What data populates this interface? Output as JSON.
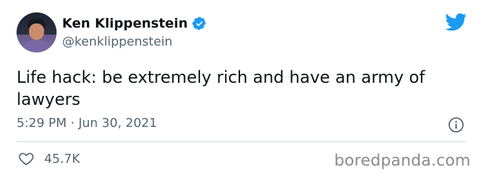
{
  "author": {
    "display_name": "Ken Klippenstein",
    "handle": "@kenklippenstein",
    "verified": true
  },
  "tweet": {
    "text": "Life hack: be extremely rich and have an army of lawyers",
    "timestamp": "5:29 PM · Jun 30, 2021",
    "like_count": "45.7K"
  },
  "icons": {
    "brand": "twitter-bird-icon",
    "verified": "verified-badge-icon",
    "info": "info-icon",
    "like": "heart-icon"
  },
  "colors": {
    "brand_blue": "#1d9bf0",
    "text_primary": "#0f1419",
    "text_secondary": "#536471"
  },
  "watermark": "boredpanda.com"
}
